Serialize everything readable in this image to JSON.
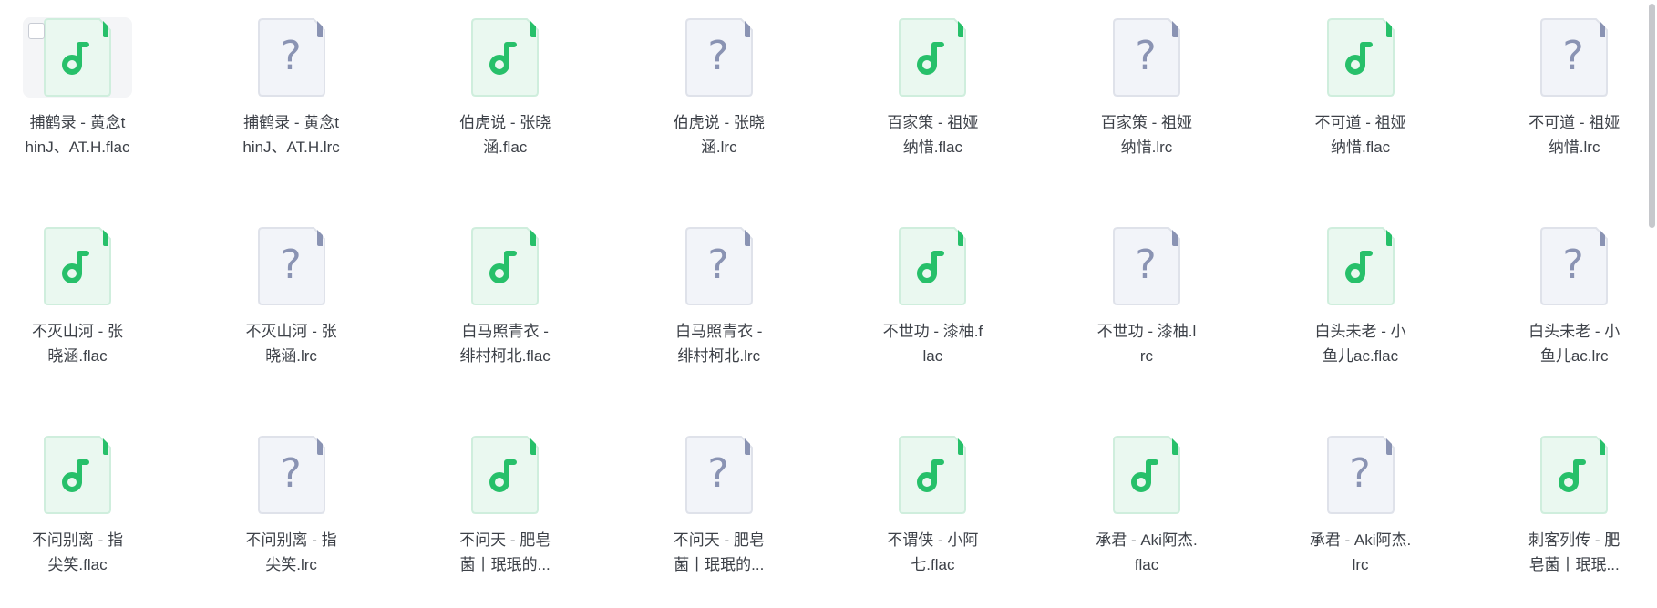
{
  "files": [
    {
      "type": "music",
      "line1": "捕鹤录 - 黄念t",
      "line2": "hinJ、AT.H.flac",
      "selected": true
    },
    {
      "type": "unknown",
      "line1": "捕鹤录 - 黄念t",
      "line2": "hinJ、AT.H.lrc"
    },
    {
      "type": "music",
      "line1": "伯虎说 - 张晓",
      "line2": "涵.flac"
    },
    {
      "type": "unknown",
      "line1": "伯虎说 - 张晓",
      "line2": "涵.lrc"
    },
    {
      "type": "music",
      "line1": "百家策 - 祖娅",
      "line2": "纳惜.flac"
    },
    {
      "type": "unknown",
      "line1": "百家策 - 祖娅",
      "line2": "纳惜.lrc"
    },
    {
      "type": "music",
      "line1": "不可道 - 祖娅",
      "line2": "纳惜.flac"
    },
    {
      "type": "unknown",
      "line1": "不可道 - 祖娅",
      "line2": "纳惜.lrc"
    },
    {
      "type": "music",
      "line1": "不灭山河 - 张",
      "line2": "晓涵.flac"
    },
    {
      "type": "unknown",
      "line1": "不灭山河 - 张",
      "line2": "晓涵.lrc"
    },
    {
      "type": "music",
      "line1": "白马照青衣 -",
      "line2": "绯村柯北.flac"
    },
    {
      "type": "unknown",
      "line1": "白马照青衣 -",
      "line2": "绯村柯北.lrc"
    },
    {
      "type": "music",
      "line1": "不世功 - 漆柚.f",
      "line2": "lac"
    },
    {
      "type": "unknown",
      "line1": "不世功 - 漆柚.l",
      "line2": "rc"
    },
    {
      "type": "music",
      "line1": "白头未老 - 小",
      "line2": "鱼儿ac.flac"
    },
    {
      "type": "unknown",
      "line1": "白头未老 - 小",
      "line2": "鱼儿ac.lrc"
    },
    {
      "type": "music",
      "line1": "不问别离 - 指",
      "line2": "尖笑.flac"
    },
    {
      "type": "unknown",
      "line1": "不问别离 - 指",
      "line2": "尖笑.lrc"
    },
    {
      "type": "music",
      "line1": "不问天 - 肥皂",
      "line2": "菌丨珉珉的..."
    },
    {
      "type": "unknown",
      "line1": "不问天 - 肥皂",
      "line2": "菌丨珉珉的..."
    },
    {
      "type": "music",
      "line1": "不谓侠 - 小阿",
      "line2": "七.flac"
    },
    {
      "type": "music",
      "line1": "承君 - Aki阿杰.",
      "line2": "flac"
    },
    {
      "type": "unknown",
      "line1": "承君 - Aki阿杰.",
      "line2": "lrc"
    },
    {
      "type": "music",
      "line1": "刺客列传 - 肥",
      "line2": "皂菌丨珉珉..."
    }
  ],
  "colors": {
    "music_body": "#eaf8f0",
    "music_border": "#cfeedd",
    "music_fold": "#27c06a",
    "music_note": "#27c06a",
    "unknown_body": "#f2f4f9",
    "unknown_border": "#dfe2ea",
    "unknown_fold": "#8a93b3",
    "unknown_glyph": "#8a93b3"
  },
  "icons": {
    "music": "music-file-icon",
    "unknown": "unknown-file-icon"
  }
}
